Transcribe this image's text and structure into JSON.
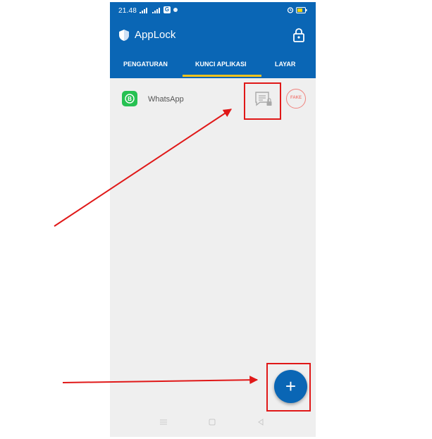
{
  "status_bar": {
    "time": "21.48",
    "sim_badge": "G"
  },
  "app_bar": {
    "title": "AppLock",
    "shield_icon": "shield-icon",
    "lock_icon": "lock-icon"
  },
  "tabs": [
    {
      "label": "PENGATURAN",
      "selected": false
    },
    {
      "label": "KUNCI APLIKASI",
      "selected": true
    },
    {
      "label": "LAYAR",
      "selected": false
    }
  ],
  "app_list": [
    {
      "name": "WhatsApp",
      "icon": "whatsapp-business-icon",
      "icon_letter": "B",
      "fake_label": "FAKE"
    }
  ],
  "fab": {
    "label": "+"
  },
  "colors": {
    "primary": "#0a66b5",
    "tab_indicator": "#f6c21c",
    "highlight": "#e01818",
    "whatsapp_green": "#26c152",
    "fake_red": "#f0837e"
  }
}
